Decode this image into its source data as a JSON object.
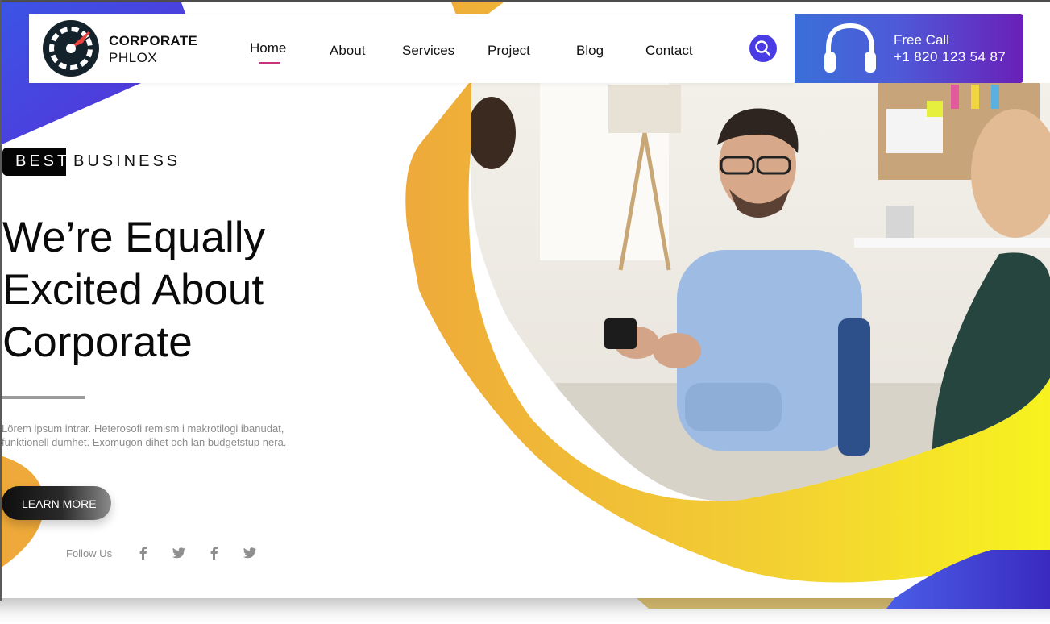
{
  "logo": {
    "line1": "CORPORATE",
    "line2": "PHLOX"
  },
  "nav": {
    "items": [
      {
        "label": "Home",
        "active": true
      },
      {
        "label": "About"
      },
      {
        "label": "Services"
      },
      {
        "label": "Project"
      },
      {
        "label": "Blog"
      },
      {
        "label": "Contact"
      }
    ]
  },
  "header": {
    "search_icon": "search-icon"
  },
  "call": {
    "title": "Free Call",
    "phone": "+1 820 123 54 87",
    "icon": "headphones-icon"
  },
  "hero": {
    "badge_highlight": "BEST",
    "badge_rest": "BUSINESS",
    "title_lines": [
      "We’re Equally",
      "Excited About",
      "Corporate"
    ],
    "description": "Lörem ipsum intrar. Heterosofi remism i makrotilogi ibanudat, funktionell dumhet. Exomugon dihet och lan budgetstup nera.",
    "cta": "LEARN MORE"
  },
  "follow": {
    "label": "Follow Us",
    "icons": [
      "facebook-icon",
      "twitter-icon",
      "facebook-icon",
      "twitter-icon"
    ]
  },
  "colors": {
    "accent_purple": "#4a3ce4",
    "call_gradient_start": "#3b6fd8",
    "call_gradient_end": "#6a1fb8",
    "yellow_band": "#f5c432",
    "nav_underline": "#c8347b"
  }
}
